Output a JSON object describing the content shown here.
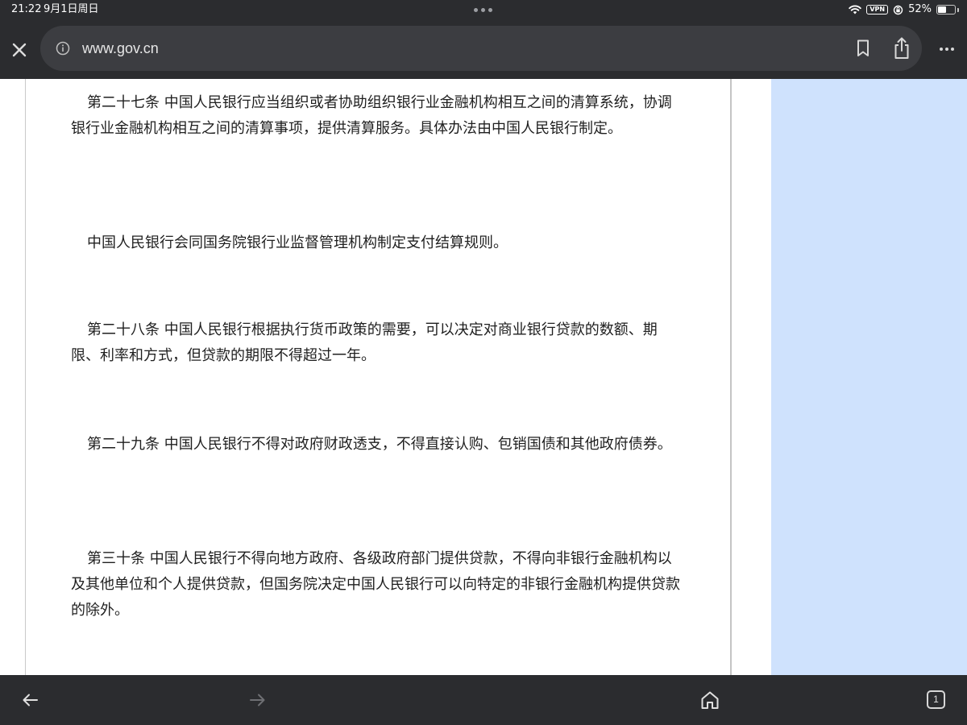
{
  "status_bar": {
    "time": "21:22",
    "date": "9月1日周日",
    "vpn": "VPN",
    "battery_percent": "52%",
    "battery_level": 0.52
  },
  "browser": {
    "url": "www.gov.cn",
    "open_tab_count": "1"
  },
  "article": {
    "paragraphs": [
      "第二十七条 中国人民银行应当组织或者协助组织银行业金融机构相互之间的清算系统，协调银行业金融机构相互之间的清算事项，提供清算服务。具体办法由中国人民银行制定。",
      "中国人民银行会同国务院银行业监督管理机构制定支付结算规则。",
      "第二十八条 中国人民银行根据执行货币政策的需要，可以决定对商业银行贷款的数额、期限、利率和方式，但贷款的期限不得超过一年。",
      "第二十九条 中国人民银行不得对政府财政透支，不得直接认购、包销国债和其他政府债券。",
      "第三十条 中国人民银行不得向地方政府、各级政府部门提供贷款，不得向非银行金融机构以及其他单位和个人提供贷款，但国务院决定中国人民银行可以向特定的非银行金融机构提供贷款的除外。"
    ]
  },
  "colors": {
    "chrome_dark": "#2b2c2f",
    "url_bar": "#3c3d41",
    "side_panel": "#cfe2fd",
    "text": "#1f1f1f"
  },
  "icons": {
    "status": [
      "wifi-icon",
      "vpn-badge",
      "orientation-lock-icon",
      "battery-icon"
    ],
    "toolbar": [
      "close-icon",
      "info-icon",
      "bookmark-icon",
      "share-icon",
      "more-icon"
    ],
    "bottom": [
      "back-arrow-icon",
      "forward-arrow-icon",
      "home-icon",
      "tabs-icon"
    ]
  }
}
